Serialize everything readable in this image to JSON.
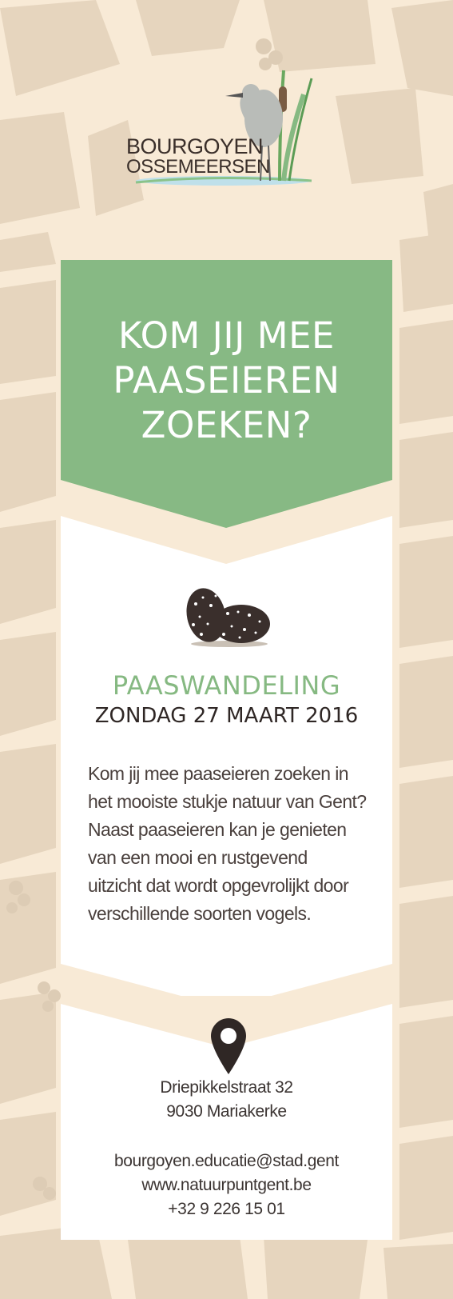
{
  "brand": {
    "title": "BOURGOYEN",
    "subtitle": "OSSEMEERSEN"
  },
  "headline": {
    "line1": "KOM JIJ MEE",
    "line2": "PAASEIEREN",
    "line3": "ZOEKEN?"
  },
  "event": {
    "title": "PAASWANDELING",
    "date": "ZONDAG 27 MAART 2016"
  },
  "description": {
    "line1": "Kom jij mee paaseieren zoeken in",
    "line2": "het mooiste stukje natuur van Gent?",
    "line3": "Naast paaseieren kan je genieten",
    "line4": "van een mooi en rustgevend",
    "line5": "uitzicht dat wordt opgevrolijkt door",
    "line6": "verschillende soorten vogels."
  },
  "address": {
    "street": "Driepikkelstraat 32",
    "city": "9030 Mariakerke"
  },
  "contact": {
    "email": "bourgoyen.educatie@stad.gent",
    "website": "www.natuurpuntgent.be",
    "phone": "+32 9 226 15 01"
  },
  "icons": {
    "egg": "eggs-icon",
    "location": "map-pin-icon",
    "logo": "heron-reed-logo"
  },
  "colors": {
    "background": "#f8ead6",
    "map_blocks": "#e8d8c2",
    "green": "#87b984",
    "white": "#ffffff",
    "dark": "#2f2725"
  }
}
